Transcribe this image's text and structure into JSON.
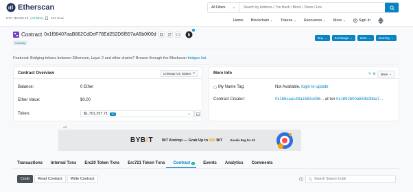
{
  "header": {
    "logo_text": "Etherscan",
    "eth_price_label": "ETH: $3,620.43",
    "eth_change": "(+0.92%)",
    "gas_label": "104 Gwei",
    "filter_label": "All Filters",
    "search_placeholder": "Search by Address / Txn Hash / Block / Token / Ens",
    "nav": [
      "Home",
      "Blockchain",
      "Tokens",
      "Resources",
      "More",
      "Sign In"
    ]
  },
  "contract": {
    "title": "Contract",
    "address": "0x1f98407aaB862CdDeF78Ed252D6f557aA5b0f00d",
    "tag": "Uniswap",
    "buy_label": "Buy",
    "exchange_label": "Exchange",
    "earn_label": "Earn",
    "gaming_label": "Gaming",
    "notification_count": "1"
  },
  "featured": {
    "text": "Featured: Bridging tokens between Ethereum, Layer 2 and other chains? Browse through the Blockscan ",
    "link": "bridges list."
  },
  "overview": {
    "title": "Contract Overview",
    "staker_label": "Uniswap V3: Staker",
    "balance_label": "Balance:",
    "balance_value": "0 Ether",
    "ether_value_label": "Ether Value:",
    "ether_value": "$0.00",
    "token_label": "Token:",
    "token_value": "$1,701,257.71",
    "token_count": "12"
  },
  "more_info": {
    "title": "More Info",
    "more_btn": "More",
    "name_tag_label": "My Name Tag:",
    "name_tag_value": "Not Available, ",
    "name_tag_link": "login to update",
    "creator_label": "Contract Creator:",
    "creator_address": "0x1b5caa1d3a1582a436...",
    "creator_at_txn": "at txn",
    "creator_txn": "0x1892b00a553b2bba7..."
  },
  "ad": {
    "label": "Ad",
    "brand_prefix": "BYB",
    "brand_accent": "!",
    "brand_suffix": "T",
    "headline_prefix": "BIT Airdrop — Grab Up to ",
    "headline_amount": "600",
    "headline_suffix": " BIT",
    "subtext": "Goodie Bag for All"
  },
  "tabs": [
    "Transactions",
    "Internal Txns",
    "Erc20 Token Txns",
    "Erc721 Token Txns",
    "Contract",
    "Events",
    "Analytics",
    "Comments"
  ],
  "active_tab": "Contract",
  "code_tabs": [
    "Code",
    "Read Contract",
    "Write Contract"
  ],
  "source_search_placeholder": "Search Source Code",
  "colors": {
    "accent": "#0784c3",
    "positive": "#00a186",
    "ad_highlight": "#f7a600"
  }
}
